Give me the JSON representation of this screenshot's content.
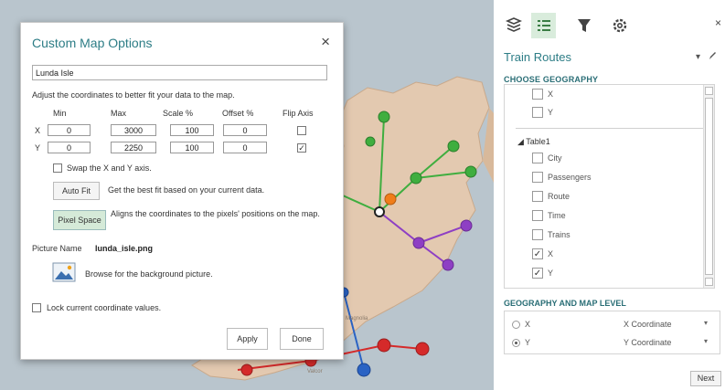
{
  "dialog": {
    "title": "Custom Map Options",
    "map_name": "Lunda Isle",
    "adjust_text": "Adjust the coordinates to better fit your data to the map.",
    "columns": {
      "min": "Min",
      "max": "Max",
      "scale": "Scale %",
      "offset": "Offset %",
      "flip": "Flip Axis"
    },
    "rows": [
      {
        "axis": "X",
        "min": "0",
        "max": "3000",
        "scale": "100",
        "offset": "0",
        "flip": false
      },
      {
        "axis": "Y",
        "min": "0",
        "max": "2250",
        "scale": "100",
        "offset": "0",
        "flip": true
      }
    ],
    "swap_label": "Swap the X and Y axis.",
    "swap_checked": false,
    "autofit_label": "Auto Fit",
    "autofit_desc": "Get the best fit based on your current data.",
    "pixel_label": "Pixel Space",
    "pixel_desc": "Aligns the coordinates to the pixels' positions on the map.",
    "picture_label": "Picture Name",
    "picture_value": "lunda_isle.png",
    "browse_text": "Browse for the background picture.",
    "lock_label": "Lock current coordinate values.",
    "lock_checked": false,
    "apply_label": "Apply",
    "done_label": "Done",
    "close_glyph": "×"
  },
  "panel": {
    "close_glyph": "×",
    "layer_name": "Train Routes",
    "layer_opts_glyph": "▾",
    "choose_header": "CHOOSE GEOGRAPHY",
    "top_fields": [
      {
        "label": "X",
        "checked": false
      },
      {
        "label": "Y",
        "checked": false
      }
    ],
    "table_node": "◢  Table1",
    "table_fields": [
      {
        "label": "City",
        "checked": false
      },
      {
        "label": "Passengers",
        "checked": false
      },
      {
        "label": "Route",
        "checked": false
      },
      {
        "label": "Time",
        "checked": false
      },
      {
        "label": "Trains",
        "checked": false
      },
      {
        "label": "X",
        "checked": true
      },
      {
        "label": "Y",
        "checked": true
      }
    ],
    "geo_header": "GEOGRAPHY AND MAP LEVEL",
    "geo_rows": [
      {
        "field": "X",
        "type": "X Coordinate",
        "selected": false
      },
      {
        "field": "Y",
        "type": "Y Coordinate",
        "selected": true
      }
    ],
    "dropdown_glyph": "▾",
    "next_label": "Next"
  },
  "map": {
    "labels": [
      "Magnolia",
      "Valcor"
    ],
    "colors": {
      "green": "#3fae3f",
      "purple": "#8e3fc4",
      "red": "#d52a2a",
      "blue": "#2a63c4",
      "orange": "#f07d1a",
      "land": "#e3c9b0",
      "water": "#b9c5cd"
    }
  },
  "icons": {
    "tab_layers": "layers-icon",
    "tab_fieldlist": "field-list-icon",
    "tab_filter": "filter-icon",
    "tab_settings": "gear-icon",
    "picture": "image-icon",
    "edit": "pencil-icon"
  }
}
